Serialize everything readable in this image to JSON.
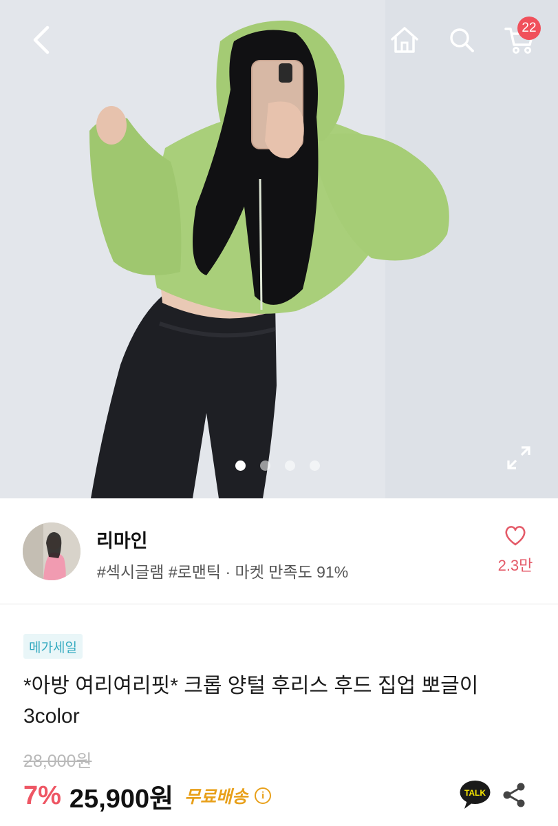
{
  "header": {
    "icons": [
      "back-icon",
      "home-icon",
      "search-icon",
      "cart-icon"
    ],
    "cart_count": "22"
  },
  "gallery": {
    "image_count": 4,
    "active_index": 0,
    "expand_icon": "expand-icon"
  },
  "seller": {
    "name": "리마인",
    "tags": "#섹시글램 #로맨틱 · 마켓 만족도 91%",
    "like_count": "2.3만",
    "like_icon": "heart-icon"
  },
  "product": {
    "badge": "메가세일",
    "title": "*아방 여리여리핏* 크롭 양털 후리스 후드 집업 뽀글이 3color",
    "original_price": "28,000원",
    "discount": "7%",
    "price": "25,900원",
    "shipping": "무료배송",
    "info_icon_label": "i",
    "talk_label": "TALK",
    "share_icon": "share-icon"
  },
  "colors": {
    "badge": "#f0505b",
    "discount": "#ee5664",
    "like": "#e45a68",
    "shipping": "#e8a01a",
    "sale_tag_text": "#34aac0",
    "sale_tag_bg": "#e9f6f8"
  }
}
